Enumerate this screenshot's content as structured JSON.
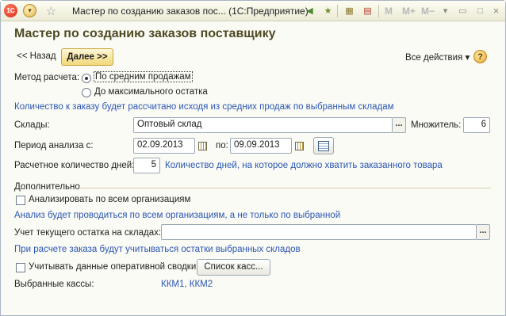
{
  "window": {
    "title": "Мастер по созданию заказов пос... (1С:Предприятие)",
    "toolbar_right": [
      "M",
      "M+",
      "M−"
    ]
  },
  "form": {
    "title": "Мастер по созданию заказов поставщику",
    "back_label": "<< Назад",
    "next_label": "Далее >>",
    "all_actions_label": "Все действия ▾",
    "help_label": "?"
  },
  "method": {
    "label": "Метод расчета:",
    "options": [
      "По средним продажам",
      "До максимального остатка"
    ],
    "selected_index": 0,
    "hint": "Количество к заказу будет рассчитано исходя из средних продаж по выбранным складам"
  },
  "warehouses": {
    "label": "Склады:",
    "value": "Оптовый склад",
    "multiplier_label": "Множитель:",
    "multiplier_value": "6"
  },
  "period": {
    "label": "Период анализа с:",
    "from": "02.09.2013",
    "to_label": "по:",
    "to": "09.09.2013"
  },
  "days": {
    "label": "Расчетное количество дней:",
    "value": "5",
    "hint": "Количество дней, на которое должно хватить заказанного товара"
  },
  "extra": {
    "group_label": "Дополнительно",
    "analyze_all_label": "Анализировать по всем организациям",
    "analyze_all_checked": false,
    "analyze_all_hint": "Анализ будет проводиться по всем организациям, а не только по выбранной",
    "stock_label": "Учет текущего остатка на складах:",
    "stock_value": "",
    "stock_hint": "При расчете заказа будут учитываться остатки выбранных складов",
    "operative_label": "Учитывать данные оперативной сводки",
    "operative_checked": false,
    "cash_list_button": "Список касс...",
    "selected_cash_label": "Выбранные кассы:",
    "selected_cash_value": "ККМ1, ККМ2"
  },
  "icons": {
    "app_logo": "1c-logo-icon",
    "menu": "main-menu-icon",
    "favorite": "star-icon",
    "calendar": "calendar-icon",
    "period_select": "period-select-icon"
  }
}
